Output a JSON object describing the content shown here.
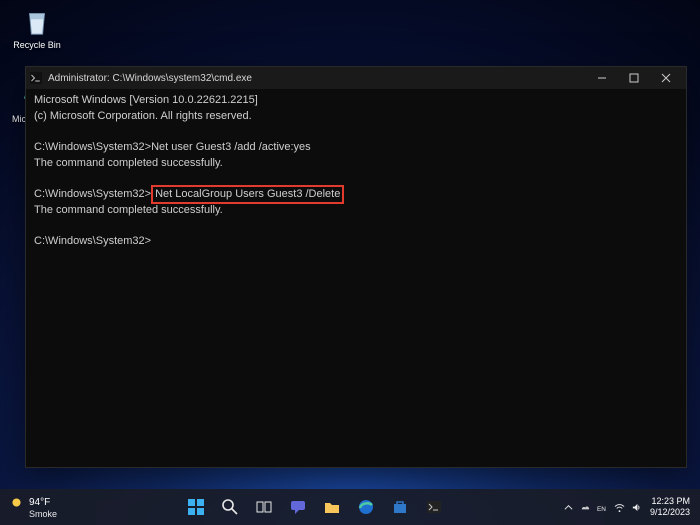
{
  "desktop": {
    "recycle": {
      "label": "Recycle Bin"
    },
    "edge": {
      "label": "Micros\nEdge"
    }
  },
  "terminal": {
    "title": "Administrator: C:\\Windows\\system32\\cmd.exe",
    "header_line1": "Microsoft Windows [Version 10.0.22621.2215]",
    "header_line2": "(c) Microsoft Corporation. All rights reserved.",
    "prompt": "C:\\Windows\\System32",
    "cmd1": "Net user Guest3 /add /active:yes",
    "result1": "The command completed successfully.",
    "cmd2": "Net LocalGroup Users Guest3 /Delete",
    "result2": "The command completed successfully.",
    "highlight_cmd": "cmd2"
  },
  "taskbar": {
    "weather": {
      "temp": "94°F",
      "desc": "Smoke"
    },
    "clock": {
      "time": "12:23 PM",
      "date": "9/12/2023"
    }
  }
}
